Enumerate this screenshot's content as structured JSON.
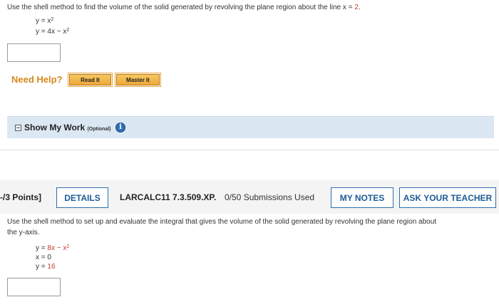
{
  "q1": {
    "prompt": "Use the shell method to find the volume of the solid generated by revolving the plane region about the line ",
    "line_var": "x = ",
    "line_value": "2",
    "line_end": ".",
    "eq1_lhs": "y = x",
    "eq1_exp": "2",
    "eq2_lhs": "y = 4x − x",
    "eq2_exp": "2"
  },
  "help": {
    "label": "Need Help?",
    "read_it": "Read It",
    "master_it": "Master It"
  },
  "show_my_work": {
    "label": "Show My Work ",
    "optional": "(Optional)"
  },
  "q2_header": {
    "points": "-/3 Points]",
    "details": "DETAILS",
    "course": "LARCALC11 7.3.509.XP.",
    "submissions": "0/50 Submissions Used",
    "my_notes": "MY NOTES",
    "ask_teacher": "ASK YOUR TEACHER"
  },
  "q2": {
    "prompt_line1": "Use the shell method to set up and evaluate the integral that gives the volume of the solid generated by revolving the plane region about",
    "prompt_line2": "the y-axis.",
    "eq1_lhs": "y = ",
    "eq1_val": "8x − x",
    "eq1_exp": "2",
    "eq2_lhs": "x = 0",
    "eq3_lhs": "y = ",
    "eq3_val": "16"
  },
  "colors": {
    "accent_red": "#c0392b",
    "help_orange": "#d4891c",
    "button_blue": "#2c6fad",
    "panel_blue": "#dbe8f3"
  }
}
